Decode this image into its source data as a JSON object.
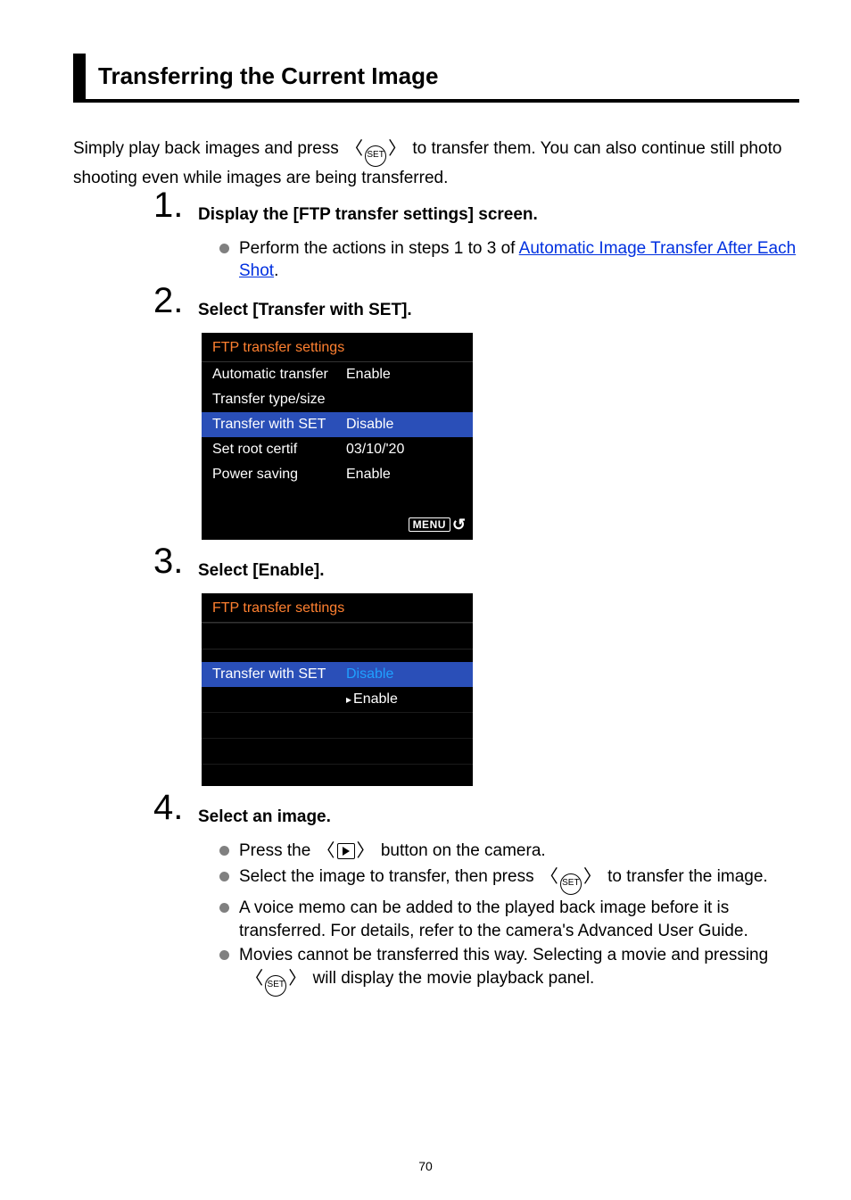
{
  "heading": "Transferring the Current Image",
  "intro_a": "Simply play back images and press ",
  "intro_b": " to transfer them. You can also continue still photo shooting even while images are being transferred.",
  "set_label": "SET",
  "steps": {
    "s1": {
      "title": "Display the [FTP transfer settings] screen.",
      "bullet_pre": "Perform the actions in steps 1 to 3 of ",
      "link": "Automatic Image Transfer After Each Shot",
      "bullet_post": "."
    },
    "s2": {
      "title": "Select [Transfer with SET].",
      "screen": {
        "header": "FTP transfer settings",
        "rows": [
          {
            "label": "Automatic transfer",
            "value": "Enable",
            "hl": false
          },
          {
            "label": "Transfer type/size",
            "value": "",
            "hl": false
          },
          {
            "label": "Transfer with SET",
            "value": "Disable",
            "hl": true
          },
          {
            "label": "Set root certif",
            "value": "03/10/'20",
            "hl": false
          },
          {
            "label": "Power saving",
            "value": "Enable",
            "hl": false
          }
        ],
        "menu": "MENU"
      }
    },
    "s3": {
      "title": "Select [Enable].",
      "screen": {
        "header": "FTP transfer settings",
        "row_label": "Transfer with SET",
        "opt_disable": "Disable",
        "opt_enable": "Enable"
      }
    },
    "s4": {
      "title": "Select an image.",
      "b1_a": "Press the ",
      "b1_b": " button on the camera.",
      "b2_a": "Select the image to transfer, then press ",
      "b2_b": " to transfer the image.",
      "b3": "A voice memo can be added to the played back image before it is transferred. For details, refer to the camera's Advanced User Guide.",
      "b4_a": "Movies cannot be transferred this way. Selecting a movie and pressing ",
      "b4_b": " will display the movie playback panel."
    }
  },
  "page_number": "70"
}
